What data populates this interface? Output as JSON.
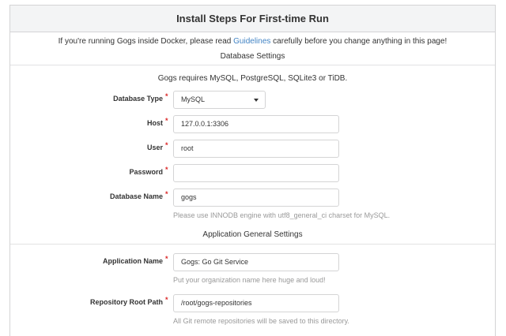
{
  "header": {
    "title": "Install Steps For First-time Run"
  },
  "docker_note": {
    "before": "If you're running Gogs inside Docker, please read ",
    "link": "Guidelines",
    "after": " carefully before you change anything in this page!"
  },
  "database": {
    "section_title": "Database Settings",
    "requires_note": "Gogs requires MySQL, PostgreSQL, SQLite3 or TiDB.",
    "db_type": {
      "label": "Database Type",
      "value": "MySQL"
    },
    "host": {
      "label": "Host",
      "value": "127.0.0.1:3306"
    },
    "user": {
      "label": "User",
      "value": "root"
    },
    "password": {
      "label": "Password",
      "value": ""
    },
    "db_name": {
      "label": "Database Name",
      "value": "gogs",
      "help": "Please use INNODB engine with utf8_general_ci charset for MySQL."
    }
  },
  "application": {
    "section_title": "Application General Settings",
    "app_name": {
      "label": "Application Name",
      "value": "Gogs: Go Git Service",
      "help": "Put your organization name here huge and loud!"
    },
    "repo_root": {
      "label": "Repository Root Path",
      "value": "/root/gogs-repositories",
      "help": "All Git remote repositories will be saved to this directory."
    }
  },
  "required_marker": "*",
  "colors": {
    "link": "#4183c4",
    "required": "#db2828",
    "help": "#999999"
  }
}
